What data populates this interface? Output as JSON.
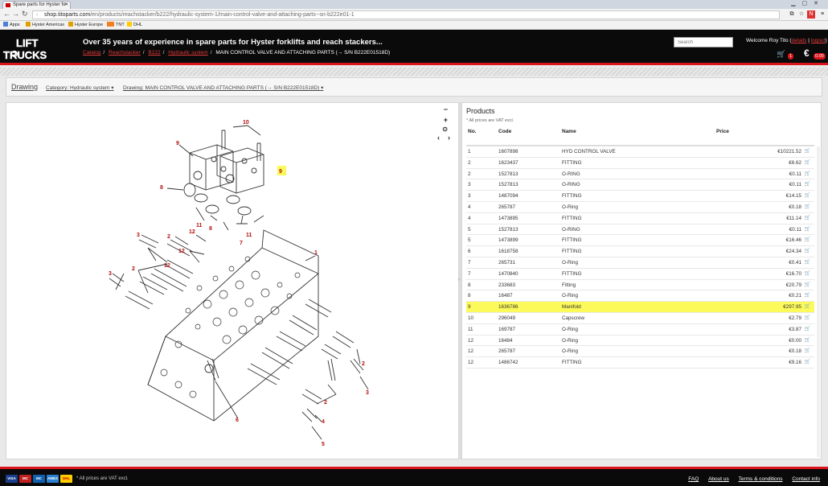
{
  "browser": {
    "tab_title": "Spare parts for Hyster fo",
    "url_host": "shop.titoparts.com",
    "url_path": "/en/products/reachstacker/b222/hydraulic-system-1/main-control-valve-and-attaching-parts--sn-b222e01-1",
    "bookmarks": [
      "Apps",
      "Hyster Americas",
      "Hyster Europe",
      "TNT",
      "DHL"
    ]
  },
  "header": {
    "logo_top": "LIFT",
    "logo_bottom": "TRUCKS",
    "tagline": "Over 35 years of experience in spare parts for Hyster forklifts and reach stackers...",
    "breadcrumb": [
      "Catalog",
      "Reachstacker",
      "B222",
      "Hydraulic system"
    ],
    "breadcrumb_current": "MAIN CONTROL VALVE AND ATTACHING PARTS (→ S/N B222E01518D)",
    "search_placeholder": "Search",
    "welcome": "Welcome Roy Tito (",
    "details_link": "details",
    "separator": "|",
    "logout_link": "logout",
    "welcome_end": ")",
    "cart_count": "1",
    "euro_symbol": "€",
    "cart_total": "0.00"
  },
  "toolbar": {
    "title": "Drawing",
    "category_label": "Category: Hydraulic system",
    "drawing_label": "Drawing: MAIN CONTROL VALVE AND ATTACHING PARTS (→ S/N B222E01518D)"
  },
  "drawing": {
    "zoom_out": "−",
    "zoom_in": "+",
    "reset": "⊙",
    "prev": "‹",
    "next": "›",
    "callouts": {
      "c1": "1",
      "c2a": "2",
      "c2b": "2",
      "c2c": "2",
      "c2d": "2",
      "c3a": "3",
      "c3b": "3",
      "c3c": "3",
      "c4": "4",
      "c5": "5",
      "c6": "6",
      "c7": "7",
      "c8a": "8",
      "c8b": "8",
      "c9a": "9",
      "c9b": "9",
      "c10": "10",
      "c11a": "11",
      "c11b": "11",
      "c12a": "12",
      "c12b": "12",
      "c12c": "12"
    }
  },
  "products": {
    "title": "Products",
    "vat_note": "* All prices are VAT excl.",
    "headers": {
      "no": "No.",
      "code": "Code",
      "name": "Name",
      "price": "Price"
    },
    "highlight_color": "#fcfa5a",
    "rows": [
      {
        "no": "1",
        "code": "1607898",
        "name": "HYD CONTROL VALVE",
        "price": "€10221.52"
      },
      {
        "no": "2",
        "code": "1623437",
        "name": "FITTING",
        "price": "€6.62"
      },
      {
        "no": "2",
        "code": "1527813",
        "name": "O-RING",
        "price": "€0.11"
      },
      {
        "no": "3",
        "code": "1527813",
        "name": "O-RING",
        "price": "€0.11"
      },
      {
        "no": "3",
        "code": "1487094",
        "name": "FITTING",
        "price": "€14.15"
      },
      {
        "no": "4",
        "code": "265787",
        "name": "O-Ring",
        "price": "€0.18"
      },
      {
        "no": "4",
        "code": "1473895",
        "name": "FITTING",
        "price": "€11.14"
      },
      {
        "no": "5",
        "code": "1527813",
        "name": "O-RING",
        "price": "€0.11"
      },
      {
        "no": "5",
        "code": "1473899",
        "name": "FITTING",
        "price": "€16.46"
      },
      {
        "no": "6",
        "code": "1618758",
        "name": "FITTING",
        "price": "€24.34"
      },
      {
        "no": "7",
        "code": "265731",
        "name": "O-Ring",
        "price": "€0.41"
      },
      {
        "no": "7",
        "code": "1470840",
        "name": "FITTING",
        "price": "€16.70"
      },
      {
        "no": "8",
        "code": "233683",
        "name": "Fitting",
        "price": "€20.79"
      },
      {
        "no": "8",
        "code": "16487",
        "name": "O-Ring",
        "price": "€0.21"
      },
      {
        "no": "9",
        "code": "1636786",
        "name": "Manifold",
        "price": "€297.95",
        "highlight": true
      },
      {
        "no": "10",
        "code": "296049",
        "name": "Capscrew",
        "price": "€2.79"
      },
      {
        "no": "11",
        "code": "169787",
        "name": "O-Ring",
        "price": "€3.87"
      },
      {
        "no": "12",
        "code": "16484",
        "name": "O-Ring",
        "price": "€0.00"
      },
      {
        "no": "12",
        "code": "265787",
        "name": "O-Ring",
        "price": "€0.18"
      },
      {
        "no": "12",
        "code": "1486742",
        "name": "FITTING",
        "price": "€9.16"
      }
    ]
  },
  "footer": {
    "cards": [
      "VISA",
      "MC",
      "MC",
      "AMEX",
      "DHL"
    ],
    "vat_note": "* All prices are VAT excl.",
    "links": [
      "FAQ",
      "About us",
      "Terms & conditions",
      "Contact info"
    ]
  }
}
